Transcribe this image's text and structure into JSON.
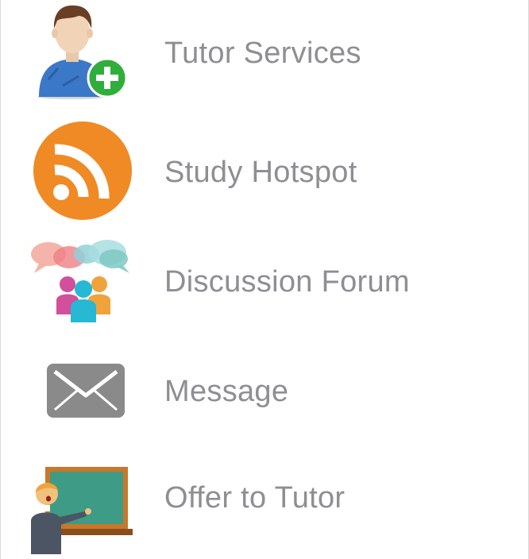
{
  "menu": {
    "items": [
      {
        "label": "Tutor Services",
        "icon": "user-add-icon"
      },
      {
        "label": "Study Hotspot",
        "icon": "rss-feed-icon"
      },
      {
        "label": "Discussion Forum",
        "icon": "discussion-group-icon"
      },
      {
        "label": "Message",
        "icon": "envelope-icon"
      },
      {
        "label": "Offer to Tutor",
        "icon": "teacher-blackboard-icon"
      }
    ]
  },
  "colors": {
    "label_text": "#8e8e93",
    "rss_orange": "#f08a24",
    "add_green": "#2fae3b",
    "envelope_gray": "#8a8a8a",
    "board_green": "#3e9b86",
    "board_frame": "#c8782a"
  }
}
